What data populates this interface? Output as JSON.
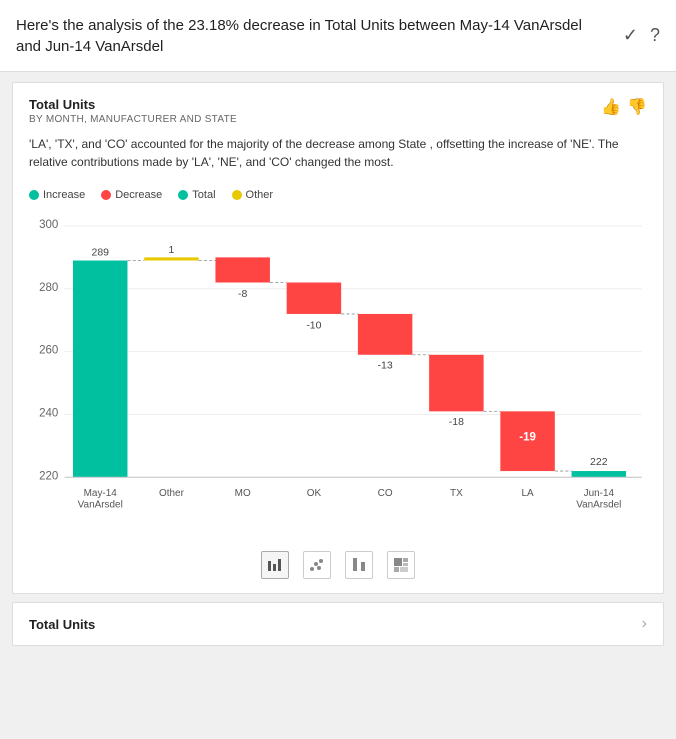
{
  "header": {
    "title": "Here's the analysis of the 23.18% decrease in Total Units between May-14 VanArsdel and Jun-14 VanArsdel",
    "check_icon": "✓",
    "help_icon": "?"
  },
  "card": {
    "title": "Total Units",
    "subtitle": "BY MONTH, MANUFACTURER AND STATE",
    "description": "'LA', 'TX', and 'CO' accounted for the majority of the decrease among State , offsetting the increase of 'NE'. The relative contributions made by 'LA', 'NE', and 'CO' changed the most.",
    "thumbup_icon": "👍",
    "thumbdown_icon": "👎",
    "legend": [
      {
        "label": "Increase",
        "color": "#00C0A0"
      },
      {
        "label": "Decrease",
        "color": "#FF4444"
      },
      {
        "label": "Total",
        "color": "#00C0A0"
      },
      {
        "label": "Other",
        "color": "#E8C800"
      }
    ],
    "chart": {
      "y_labels": [
        "300",
        "280",
        "260",
        "240",
        "220"
      ],
      "bars": [
        {
          "label": "May-14\nVanArsdel",
          "value": 289,
          "type": "total",
          "color": "#00C0A0"
        },
        {
          "label": "Other",
          "value": 1,
          "type": "other",
          "color": "#E8C800"
        },
        {
          "label": "MO",
          "value": -8,
          "type": "decrease",
          "color": "#FF4444"
        },
        {
          "label": "OK",
          "value": -10,
          "type": "decrease",
          "color": "#FF4444"
        },
        {
          "label": "CO",
          "value": -13,
          "type": "decrease",
          "color": "#FF4444"
        },
        {
          "label": "TX",
          "value": -18,
          "type": "decrease",
          "color": "#FF4444"
        },
        {
          "label": "LA",
          "value": -19,
          "type": "decrease",
          "color": "#FF4444"
        },
        {
          "label": "Jun-14\nVanArsdel",
          "value": 222,
          "type": "total",
          "color": "#00C0A0"
        }
      ]
    },
    "chart_icons": [
      {
        "id": "bar-chart",
        "active": true,
        "symbol": "▦"
      },
      {
        "id": "scatter",
        "active": false,
        "symbol": "⣿"
      },
      {
        "id": "column",
        "active": false,
        "symbol": "▐"
      },
      {
        "id": "treemap",
        "active": false,
        "symbol": "▤"
      }
    ]
  },
  "bottom_card": {
    "title": "Total Units",
    "arrow": "›"
  }
}
